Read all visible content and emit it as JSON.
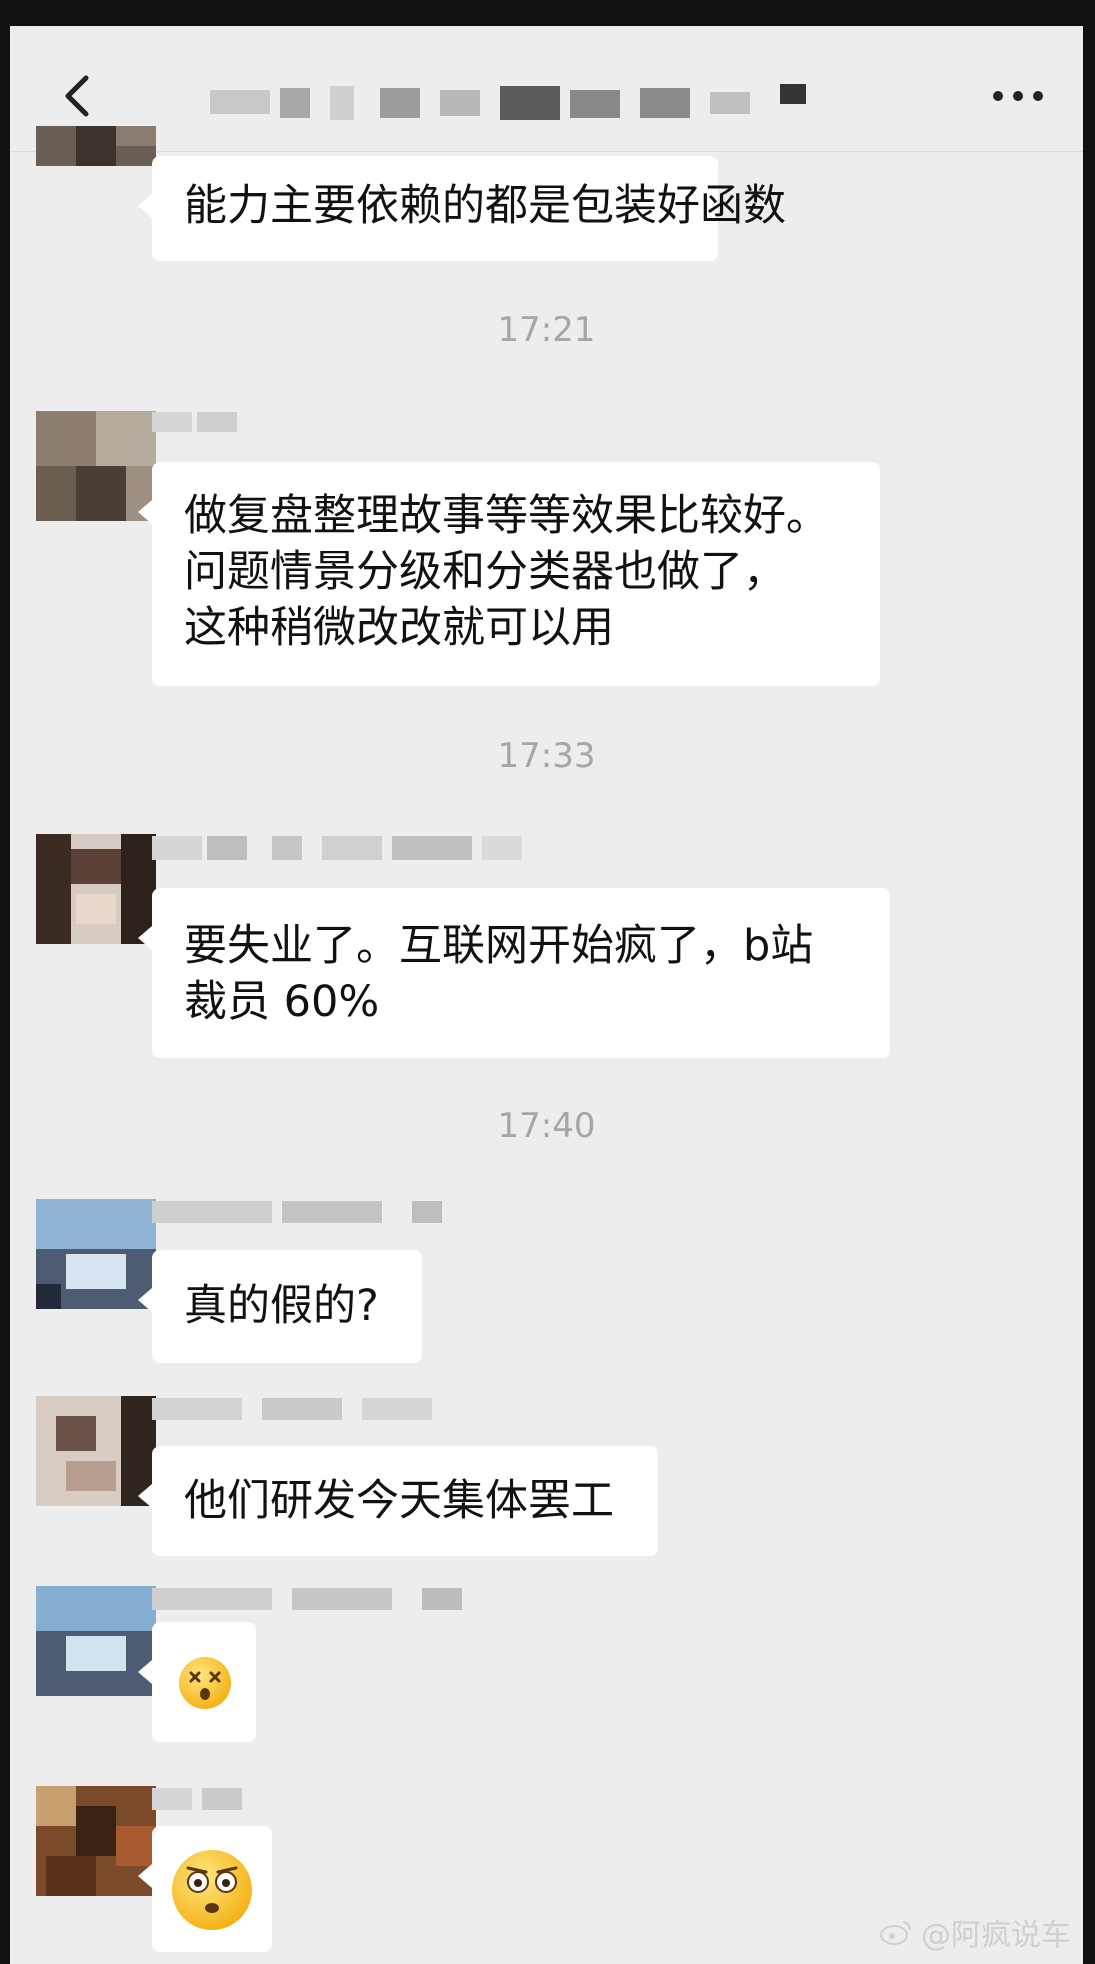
{
  "header": {
    "back_icon": "chevron-left-icon",
    "more_icon": "more-dots-icon"
  },
  "messages": [
    {
      "type": "text",
      "lines": [
        "能力主要依赖的都是包装好函数"
      ]
    },
    {
      "type": "time",
      "text": "17:21"
    },
    {
      "type": "text",
      "lines": [
        "做复盘整理故事等等效果比较好。",
        "问题情景分级和分类器也做了，",
        "这种稍微改改就可以用"
      ]
    },
    {
      "type": "time",
      "text": "17:33"
    },
    {
      "type": "text",
      "lines": [
        "要失业了。互联网开始疯了，b站",
        "裁员 60%"
      ]
    },
    {
      "type": "time",
      "text": "17:40"
    },
    {
      "type": "text",
      "lines": [
        "真的假的?"
      ]
    },
    {
      "type": "text",
      "lines": [
        "他们研发今天集体罢工"
      ]
    },
    {
      "type": "emoji",
      "name": "dizzy-face-emoji"
    },
    {
      "type": "emoji",
      "name": "shocked-face-emoji"
    }
  ],
  "watermark": {
    "text": "@阿疯说车",
    "icon": "weibo-icon"
  },
  "colors": {
    "background": "#ededed",
    "bubble": "#ffffff",
    "time": "#a6a6a6"
  }
}
